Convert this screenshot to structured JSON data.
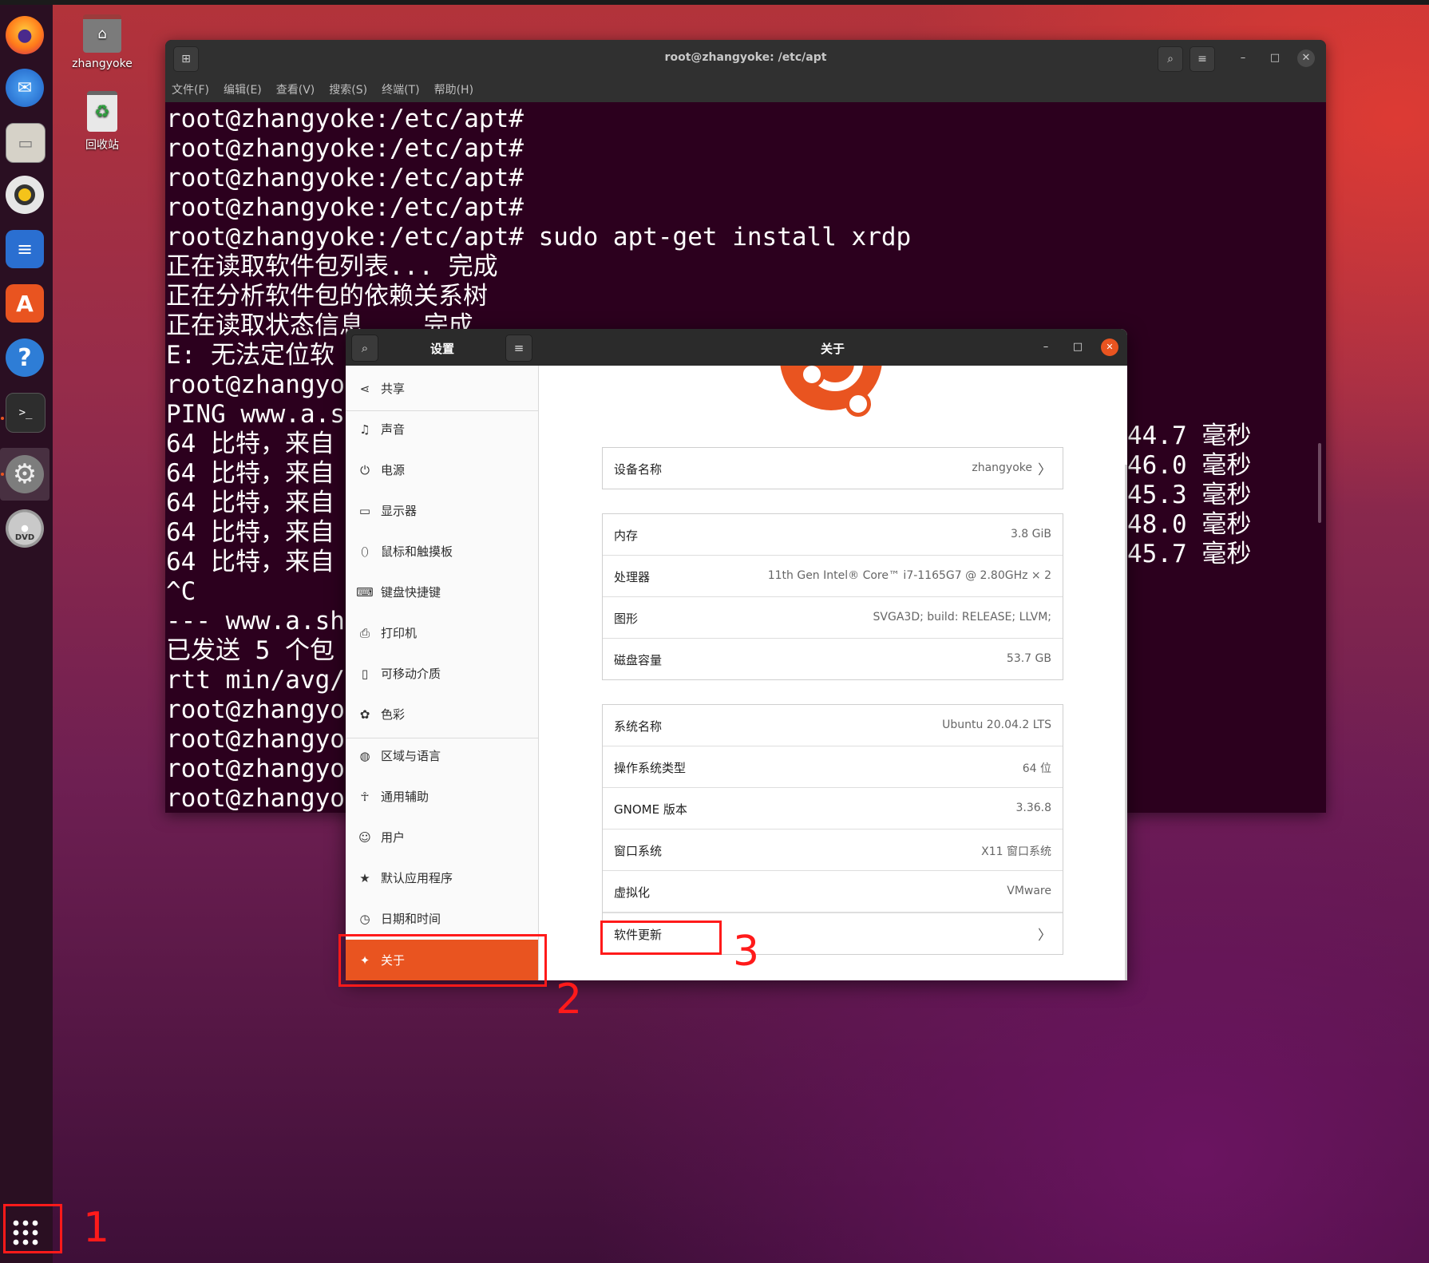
{
  "desktop": {
    "icons": [
      {
        "label": "zhangyoke",
        "icon": "home-folder-icon"
      },
      {
        "label": "回收站",
        "icon": "trash-icon"
      }
    ]
  },
  "dock": {
    "apps": [
      "firefox-icon",
      "thunderbird-icon",
      "files-icon",
      "rhythmbox-icon",
      "libreoffice-writer-icon",
      "software-center-icon",
      "help-icon",
      "terminal-icon",
      "settings-icon",
      "dvd-icon"
    ],
    "show_apps_icon": "grid-icon"
  },
  "terminal": {
    "title": "root@zhangyoke: /etc/apt",
    "menu": [
      "文件(F)",
      "编辑(E)",
      "查看(V)",
      "搜索(S)",
      "终端(T)",
      "帮助(H)"
    ],
    "lines": [
      "root@zhangyoke:/etc/apt#",
      "root@zhangyoke:/etc/apt#",
      "root@zhangyoke:/etc/apt#",
      "root@zhangyoke:/etc/apt#",
      "root@zhangyoke:/etc/apt# sudo apt-get install xrdp",
      "正在读取软件包列表... 完成",
      "正在分析软件包的依赖关系树",
      "正在读取状态信息... 完成",
      "E: 无法定位软",
      "root@zhangyok",
      "PING www.a.sh",
      "64 比特，来自",
      "64 比特，来自",
      "64 比特，来自",
      "64 比特，来自",
      "64 比特，来自",
      "^C",
      "--- www.a.sh",
      "已发送 5 个包",
      "rtt min/avg/",
      "root@zhangyok",
      "root@zhangyok",
      "root@zhangyok",
      "root@zhangyok"
    ],
    "right_lines": [
      "44.7 毫秒",
      "46.0 毫秒",
      "45.3 毫秒",
      "48.0 毫秒",
      "45.7 毫秒"
    ]
  },
  "settings": {
    "sidebar_title": "设置",
    "page_title": "关于",
    "sidebar": [
      {
        "label": "共享",
        "icon": "share-icon"
      },
      {
        "label": "声音",
        "icon": "music-note-icon"
      },
      {
        "label": "电源",
        "icon": "power-icon"
      },
      {
        "label": "显示器",
        "icon": "display-icon"
      },
      {
        "label": "鼠标和触摸板",
        "icon": "mouse-icon"
      },
      {
        "label": "键盘快捷键",
        "icon": "keyboard-icon"
      },
      {
        "label": "打印机",
        "icon": "printer-icon"
      },
      {
        "label": "可移动介质",
        "icon": "removable-media-icon"
      },
      {
        "label": "色彩",
        "icon": "color-icon"
      },
      {
        "label": "区域与语言",
        "icon": "globe-icon"
      },
      {
        "label": "通用辅助",
        "icon": "accessibility-icon"
      },
      {
        "label": "用户",
        "icon": "user-icon"
      },
      {
        "label": "默认应用程序",
        "icon": "star-icon"
      },
      {
        "label": "日期和时间",
        "icon": "clock-icon"
      },
      {
        "label": "关于",
        "icon": "sparkle-icon",
        "active": true
      }
    ],
    "device": {
      "label": "设备名称",
      "value": "zhangyoke"
    },
    "hardware": [
      {
        "label": "内存",
        "value": "3.8 GiB"
      },
      {
        "label": "处理器",
        "value": "11th Gen Intel® Core™ i7-1165G7 @ 2.80GHz × 2"
      },
      {
        "label": "图形",
        "value": "SVGA3D; build: RELEASE; LLVM;"
      },
      {
        "label": "磁盘容量",
        "value": "53.7 GB"
      }
    ],
    "system": [
      {
        "label": "系统名称",
        "value": "Ubuntu 20.04.2 LTS"
      },
      {
        "label": "操作系统类型",
        "value": "64 位"
      },
      {
        "label": "GNOME 版本",
        "value": "3.36.8"
      },
      {
        "label": "窗口系统",
        "value": "X11 窗口系统"
      },
      {
        "label": "虚拟化",
        "value": "VMware"
      }
    ],
    "software_update": {
      "label": "软件更新"
    }
  },
  "annotations": [
    "1",
    "2",
    "3"
  ],
  "colors": {
    "accent": "#e95420",
    "highlight": "#ff1a1a",
    "terminal_bg": "#2c001e"
  }
}
